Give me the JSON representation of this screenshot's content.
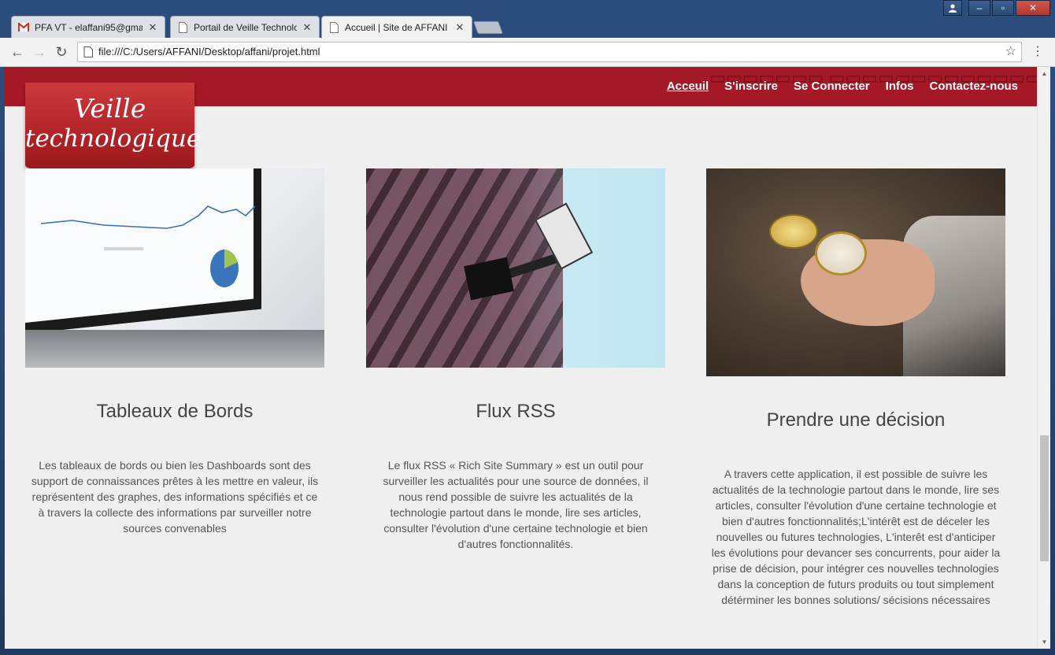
{
  "browser": {
    "tabs": [
      {
        "title": "PFA VT - elaffani95@gma",
        "icon": "gmail-icon"
      },
      {
        "title": "Portail de Veille Technolo",
        "icon": "page-icon"
      },
      {
        "title": "Accueil | Site de AFFANI",
        "icon": "page-icon",
        "active": true
      }
    ],
    "address": "file:///C:/Users/AFFANI/Desktop/affani/projet.html"
  },
  "site": {
    "brand_color": "#a51826",
    "background": "#efefef",
    "logo": {
      "line1": "Veille",
      "line2": "technologique"
    },
    "nav": [
      {
        "label": "Acceuil",
        "current": true
      },
      {
        "label": "S'inscrire"
      },
      {
        "label": "Se Connecter"
      },
      {
        "label": "Infos"
      },
      {
        "label": "Contactez-nous"
      }
    ],
    "cards": [
      {
        "title": "Tableaux de Bords",
        "image": "laptop-dashboard-photo",
        "text": "Les tableaux de bords ou bien les Dashboards sont des support de connaissances prêtes à les mettre en valeur, ils représentent des graphes, des informations spécifiés et ce à travers la collecte des informations par surveiller notre sources convenables"
      },
      {
        "title": "Flux RSS",
        "image": "security-camera-photo",
        "text": "Le flux RSS « Rich Site Summary » est un outil pour surveiller les actualités pour une source de données, il nous rend possible de suivre les actualités de la technologie partout dans le monde, lire ses articles, consulter l'évolution d'une certaine technologie et bien d'autres fonctionnalités."
      },
      {
        "title": "Prendre une décision",
        "image": "compass-in-hand-photo",
        "text": "A travers cette application, il est possible de suivre les actualités de la technologie partout dans le monde, lire ses articles, consulter l'évolution d'une certaine technologie et bien d'autres fonctionnalités;L'intérêt est de déceler les nouvelles ou futures technologies, L'interêt est d'anticiper les évolutions pour devancer ses concurrents, pour aider la prise de décision, pour intégrer ces nouvelles technologies dans la conception de futurs produits ou tout simplement détérminer les bonnes solutions/ sécisions nécessaires"
      }
    ]
  }
}
